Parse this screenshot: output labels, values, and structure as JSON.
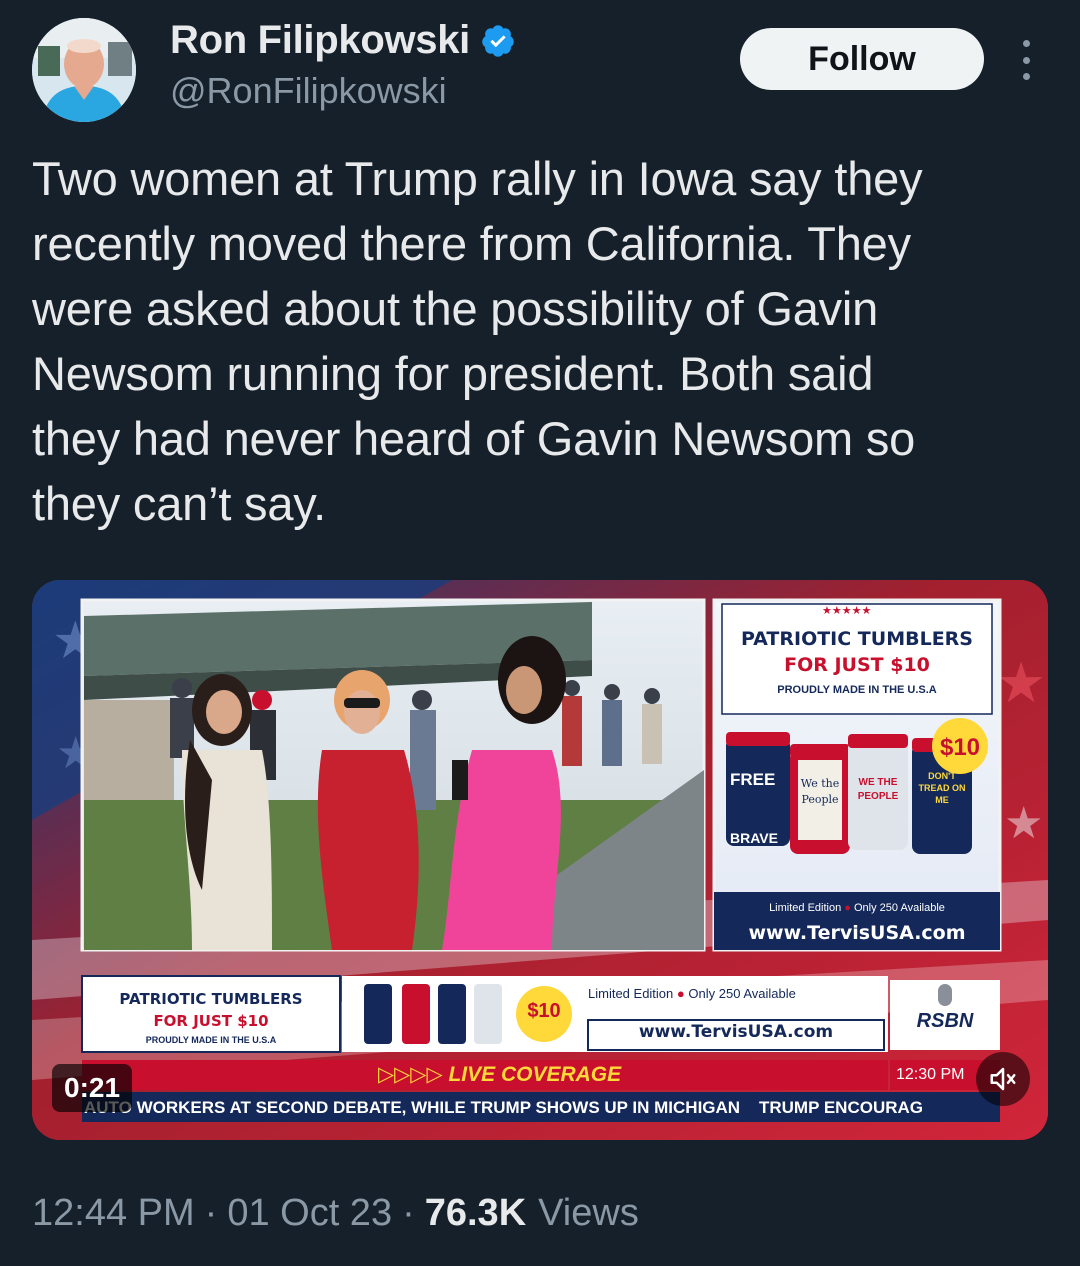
{
  "author": {
    "name": "Ron Filipkowski",
    "handle": "@RonFilipkowski",
    "verified_icon": "verified-badge-icon"
  },
  "follow_label": "Follow",
  "tweet": {
    "text": "Two women at Trump rally in Iowa say they\nrecently moved there from California. They\nwere asked about the possibility of Gavin\nNewsom running for president. Both said\nthey had never heard of Gavin Newsom so\nthey can’t say."
  },
  "video": {
    "duration": "0:21",
    "ad_side": {
      "stars": "★★★★★",
      "line1": "PATRIOTIC TUMBLERS",
      "line2": "FOR JUST $10",
      "line3": "PROUDLY MADE IN THE U.S.A",
      "price": "$10",
      "limited": "Limited Edition",
      "only": "Only 250 Available",
      "url": "www.TervisUSA.com",
      "cup_labels": [
        "FREE",
        "BRAVE",
        "We the People",
        "WE THE PEOPLE",
        "DON'T TREAD ON ME"
      ]
    },
    "ad_bottom": {
      "line1": "PATRIOTIC TUMBLERS",
      "line2": "FOR JUST $10",
      "line3": "PROUDLY MADE IN THE U.S.A",
      "price": "$10",
      "limited": "Limited Edition",
      "only": "Only 250 Available",
      "url": "www.TervisUSA.com"
    },
    "network": "RSBN",
    "live_label": "LIVE COVERAGE",
    "time": "12:30 PM",
    "ticker": "AUTO WORKERS AT SECOND DEBATE, WHILE TRUMP SHOWS UP IN MICHIGAN    TRUMP ENCOURAG"
  },
  "meta": {
    "time": "12:44 PM",
    "date": "01 Oct 23",
    "views_count": "76.3K",
    "views_label": "Views",
    "separator": "·"
  },
  "colors": {
    "background": "#15202b",
    "text": "#e7e9ea",
    "secondary": "#8b98a5",
    "verified": "#1d9bf0",
    "ad_red": "#c8102e",
    "ad_navy": "#14285a",
    "price_yellow": "#ffd83a"
  }
}
